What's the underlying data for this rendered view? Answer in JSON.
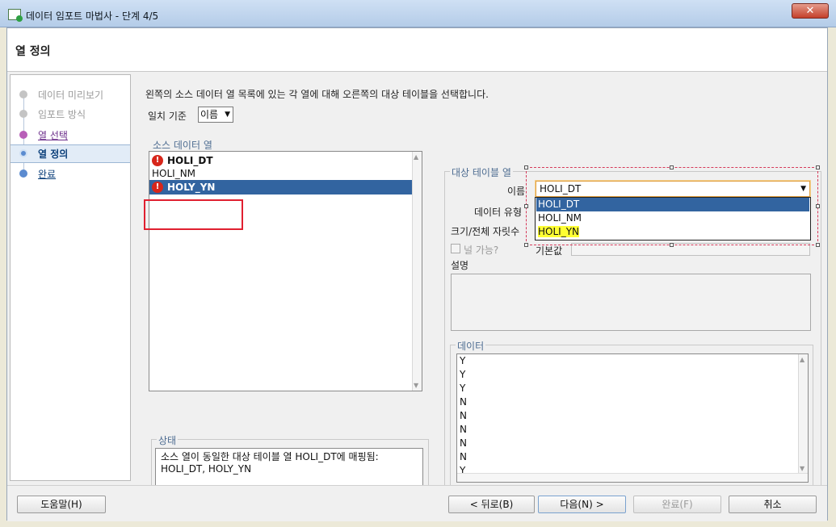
{
  "window": {
    "title": "데이터 임포트 마법사 - 단계 4/5",
    "close": "✕"
  },
  "header": {
    "title": "열 정의"
  },
  "steps": [
    {
      "label": "데이터 미리보기"
    },
    {
      "label": "임포트 방식"
    },
    {
      "label": "열 선택"
    },
    {
      "label": "열 정의"
    },
    {
      "label": "완료"
    }
  ],
  "main": {
    "instruction": "왼쪽의 소스 데이터 열 목록에 있는 각 열에 대해 오른쪽의 대상 테이블을 선택합니다.",
    "match_label": "일치 기준",
    "match_value": "이름",
    "source_group": "소스 데이터 열",
    "source_items": [
      "HOLI_DT",
      "HOLI_NM",
      "HOLY_YN"
    ],
    "status_group": "상태",
    "status_text": "소스 열이 동일한 대상 테이블 열 HOLI_DT에 매핑됨: HOLI_DT, HOLY_YN",
    "target_group": "대상 테이블 열",
    "name_label": "이름",
    "name_value": "HOLI_DT",
    "dropdown_options": [
      "HOLI_DT",
      "HOLI_NM",
      "HOLI_YN"
    ],
    "type_label": "데이터 유형",
    "size_label": "크기/전체 자릿수",
    "nullable_label": "널 가능?",
    "default_label": "기본값",
    "desc_label": "설명",
    "data_group": "데이터",
    "data_values": [
      "Y",
      "Y",
      "Y",
      "N",
      "N",
      "N",
      "N",
      "N",
      "Y"
    ]
  },
  "footer": {
    "help": "도움말(H)",
    "back": "< 뒤로(B)",
    "next": "다음(N) >",
    "finish": "완료(F)",
    "cancel": "취소"
  },
  "colors": {
    "selection": "#3264a0",
    "annotation": "#e02030",
    "highlight": "#ffff33"
  }
}
